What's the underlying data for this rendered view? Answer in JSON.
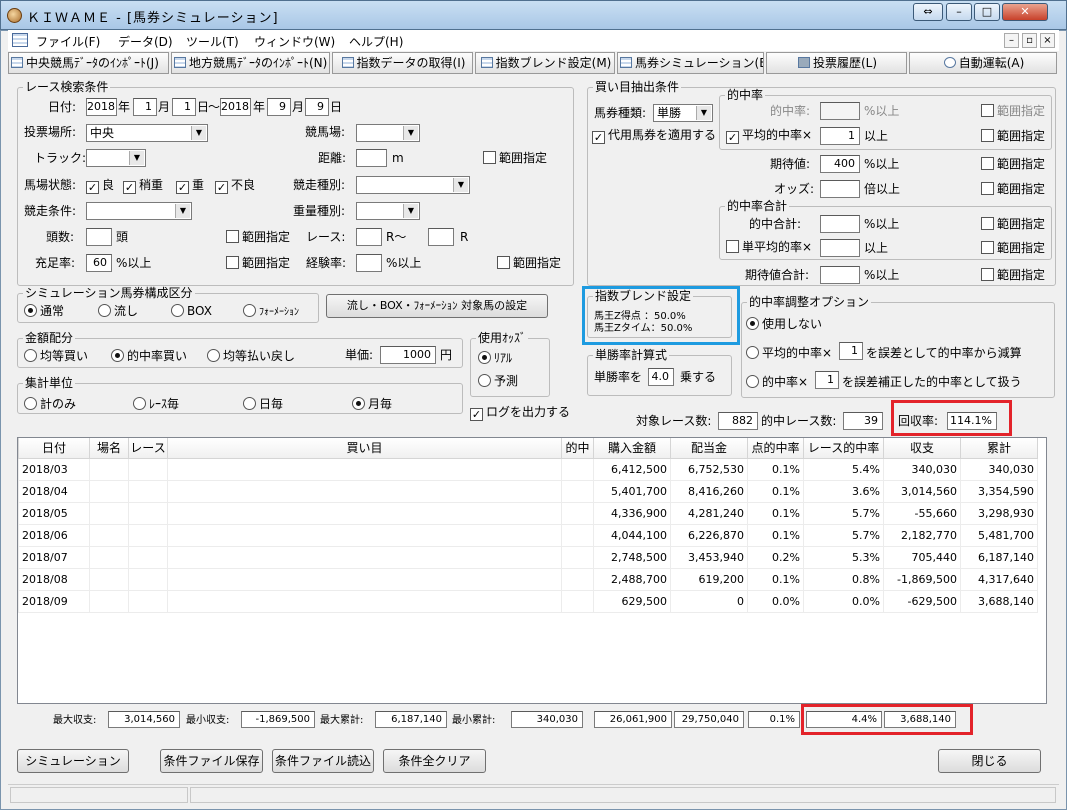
{
  "window": {
    "title": "ＫＩＷＡＭＥ - [馬券シミュレーション]"
  },
  "menu": [
    "ファイル(F)",
    "データ(D)",
    "ツール(T)",
    "ウィンドウ(W)",
    "ヘルプ(H)"
  ],
  "toolbar": [
    "中央競馬ﾃﾞｰﾀのｲﾝﾎﾟｰﾄ(J)",
    "地方競馬ﾃﾞｰﾀのｲﾝﾎﾟｰﾄ(N)",
    "指数データの取得(I)",
    "指数ブレンド設定(M)",
    "馬券シミュレーション(B)",
    "投票履歴(L)",
    "自動運転(A)"
  ],
  "race": {
    "group_label": "レース検索条件",
    "date_label": "日付:",
    "from": {
      "year": "2018",
      "month": "1",
      "day": "1"
    },
    "to": {
      "year": "2018",
      "month": "9",
      "day": "9"
    },
    "unit_year": "年",
    "unit_month": "月",
    "unit_day": "日",
    "tilde": "～",
    "venue_type_label": "投票場所:",
    "venue_type_value": "中央",
    "course_label": "競馬場:",
    "track_label": "トラック:",
    "distance_label": "距離:",
    "distance_unit": "m",
    "range_label": "範囲指定",
    "condition_label": "馬場状態:",
    "conditions": [
      "良",
      "稍重",
      "重",
      "不良"
    ],
    "race_type_label": "競走種別:",
    "race_cond_label": "競走条件:",
    "weight_label": "重量種別:",
    "heads_label": "頭数:",
    "heads_unit": "頭",
    "race_label": "レース:",
    "race_r_from": "R～",
    "race_r_to": "R",
    "fill_label": "充足率:",
    "fill_value": "60",
    "fill_unit": "%以上",
    "exp_label": "経験率:",
    "exp_unit": "%以上"
  },
  "buy": {
    "group_label": "買い目抽出条件",
    "bet_type_label": "馬券種類:",
    "bet_type_value": "単勝",
    "substitute_label": "代用馬券を適用する",
    "hit_group": "的中率",
    "hit_rate_label": "的中率:",
    "hit_rate_unit": "%以上",
    "avg_hit_label": "平均的中率×",
    "avg_hit_value": "1",
    "avg_hit_unit": "以上",
    "expect_label": "期待値:",
    "expect_value": "400",
    "expect_unit": "%以上",
    "odds_label": "オッズ:",
    "odds_unit": "倍以上",
    "hit_total_group": "的中率合計",
    "hit_total_label": "的中合計:",
    "hit_total_unit": "%以上",
    "single_avg_label": "単平均的率×",
    "single_avg_unit": "以上",
    "expect_total_label": "期待値合計:",
    "expect_total_unit": "%以上",
    "range_label": "範囲指定"
  },
  "sim_type": {
    "group_label": "シミュレーション馬券構成区分",
    "options": [
      "通常",
      "流し",
      "BOX",
      "ﾌｫｰﾒｰｼｮﾝ"
    ],
    "button": "流し・BOX・ﾌｫｰﾒｰｼｮﾝ 対象馬の設定"
  },
  "blend": {
    "group_label": "指数ブレンド設定",
    "line1": "馬王Z得点 ：50.0%",
    "line2": "馬王Zタイム：50.0%"
  },
  "win_rate": {
    "group_label": "単勝率計算式",
    "label": "単勝率を",
    "value": "4.0",
    "unit": "乗する"
  },
  "adjust": {
    "group_label": "的中率調整オプション",
    "opt1": "使用しない",
    "opt2_a": "平均的中率×",
    "opt2_v": "1",
    "opt2_b": "を誤差として的中率から減算",
    "opt3_a": "的中率×",
    "opt3_v": "1",
    "opt3_b": "を誤差補正した的中率として扱う"
  },
  "money": {
    "group_label": "金額配分",
    "options": [
      "均等買い",
      "的中率買い",
      "均等払い戻し"
    ],
    "unit_price_label": "単価:",
    "unit_price_value": "1000",
    "yen": "円"
  },
  "odds_use": {
    "group_label": "使用ｵｯｽﾞ",
    "options": [
      "ﾘｱﾙ",
      "予測"
    ]
  },
  "aggregate": {
    "group_label": "集計単位",
    "options": [
      "計のみ",
      "ﾚｰｽ毎",
      "日毎",
      "月毎"
    ]
  },
  "log_label": "ログを出力する",
  "summary": {
    "target_label": "対象レース数:",
    "target": "882",
    "hit_label": "的中レース数:",
    "hit": "39",
    "return_label": "回収率:",
    "return_rate": "114.1%"
  },
  "table": {
    "headers": [
      "日付",
      "場名",
      "レース",
      "買い目",
      "的中",
      "購入金額",
      "配当金",
      "点的中率",
      "レース的中率",
      "収支",
      "累計"
    ],
    "rows": [
      [
        "2018/03",
        "",
        "",
        "",
        "",
        "6,412,500",
        "6,752,530",
        "0.1%",
        "5.4%",
        "340,030",
        "340,030"
      ],
      [
        "2018/04",
        "",
        "",
        "",
        "",
        "5,401,700",
        "8,416,260",
        "0.1%",
        "3.6%",
        "3,014,560",
        "3,354,590"
      ],
      [
        "2018/05",
        "",
        "",
        "",
        "",
        "4,336,900",
        "4,281,240",
        "0.1%",
        "5.7%",
        "-55,660",
        "3,298,930"
      ],
      [
        "2018/06",
        "",
        "",
        "",
        "",
        "4,044,100",
        "6,226,870",
        "0.1%",
        "5.7%",
        "2,182,770",
        "5,481,700"
      ],
      [
        "2018/07",
        "",
        "",
        "",
        "",
        "2,748,500",
        "3,453,940",
        "0.2%",
        "5.3%",
        "705,440",
        "6,187,140"
      ],
      [
        "2018/08",
        "",
        "",
        "",
        "",
        "2,488,700",
        "619,200",
        "0.1%",
        "0.8%",
        "-1,869,500",
        "4,317,640"
      ],
      [
        "2018/09",
        "",
        "",
        "",
        "",
        "629,500",
        "0",
        "0.0%",
        "0.0%",
        "-629,500",
        "3,688,140"
      ]
    ]
  },
  "totals": {
    "max_income_label": "最大収支:",
    "max_income": "3,014,560",
    "min_income_label": "最小収支:",
    "min_income": "-1,869,500",
    "max_cum_label": "最大累計:",
    "max_cum": "6,187,140",
    "min_cum_label": "最小累計:",
    "min_cum": "340,030",
    "buy_total": "26,061,900",
    "pay_total": "29,750,040",
    "point_hit": "0.1%",
    "race_hit": "4.4%",
    "income_total": "3,688,140"
  },
  "buttons": {
    "simulate": "シミュレーション",
    "save": "条件ファイル保存",
    "load": "条件ファイル読込",
    "clear": "条件全クリア",
    "close": "閉じる"
  },
  "colors": {
    "highlight_red": "#e3232a",
    "highlight_blue": "#1e9be0",
    "title_bar": "#b8d3ee"
  }
}
